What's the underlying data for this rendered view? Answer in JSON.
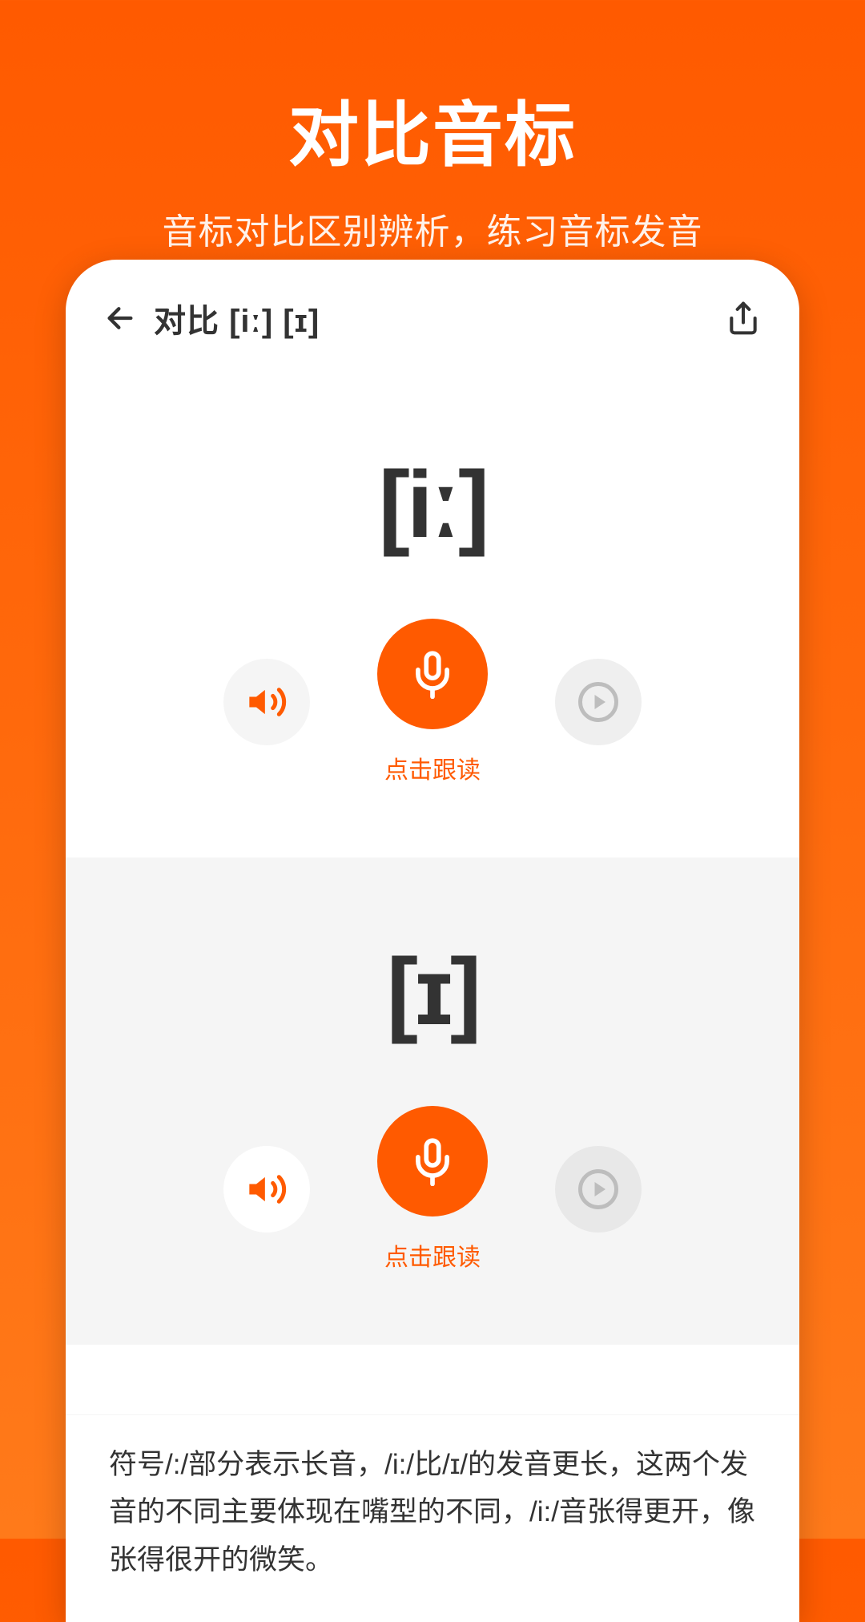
{
  "hero": {
    "title": "对比音标",
    "subtitle": "音标对比区别辨析，练习音标发音"
  },
  "header": {
    "title": "对比 [iː] [ɪ]"
  },
  "cards": [
    {
      "phonetic": "[iː]",
      "mic_label": "点击跟读"
    },
    {
      "phonetic": "[ɪ]",
      "mic_label": "点击跟读"
    }
  ],
  "note": "符号/:/部分表示长音，/i:/比/ɪ/的发音更长，这两个发音的不同主要体现在嘴型的不同，/i:/音张得更开，像张得很开的微笑。",
  "colors": {
    "accent": "#ff5a00"
  }
}
